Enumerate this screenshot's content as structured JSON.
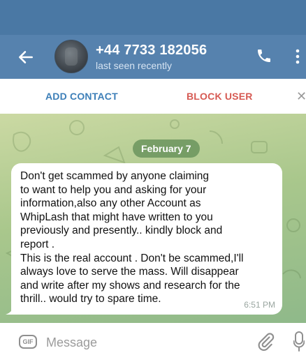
{
  "header": {
    "title": "+44 7733 182056",
    "status": "last seen recently"
  },
  "actions": {
    "add_contact": "ADD CONTACT",
    "block_user": "BLOCK USER",
    "close_glyph": "✕"
  },
  "chat": {
    "date": "February 7",
    "message": {
      "text": "Don't get scammed by anyone claiming\nto want to help you and asking for your\ninformation,also any other Account as\nWhipLash that might have written to you\npreviously and presently.. kindly block and\nreport .\nThis is the real account . Don't be scammed,I'll\nalways love to serve the mass. Will disappear\nand write after my shows and research for the\nthrill.. would try to spare time.",
      "time": "6:51 PM"
    }
  },
  "composer": {
    "gif_label": "GIF",
    "placeholder": "Message"
  },
  "icons": {
    "back": "arrow-left",
    "call": "phone",
    "more": "vertical-dots",
    "attach": "paperclip",
    "voice": "microphone"
  },
  "colors": {
    "status_bar": "#4a78a4",
    "header": "#5682ae",
    "add_contact": "#3d7fb8",
    "block_user": "#d65a53",
    "chat_bg": "#a9c78c",
    "bubble": "#ffffff"
  }
}
